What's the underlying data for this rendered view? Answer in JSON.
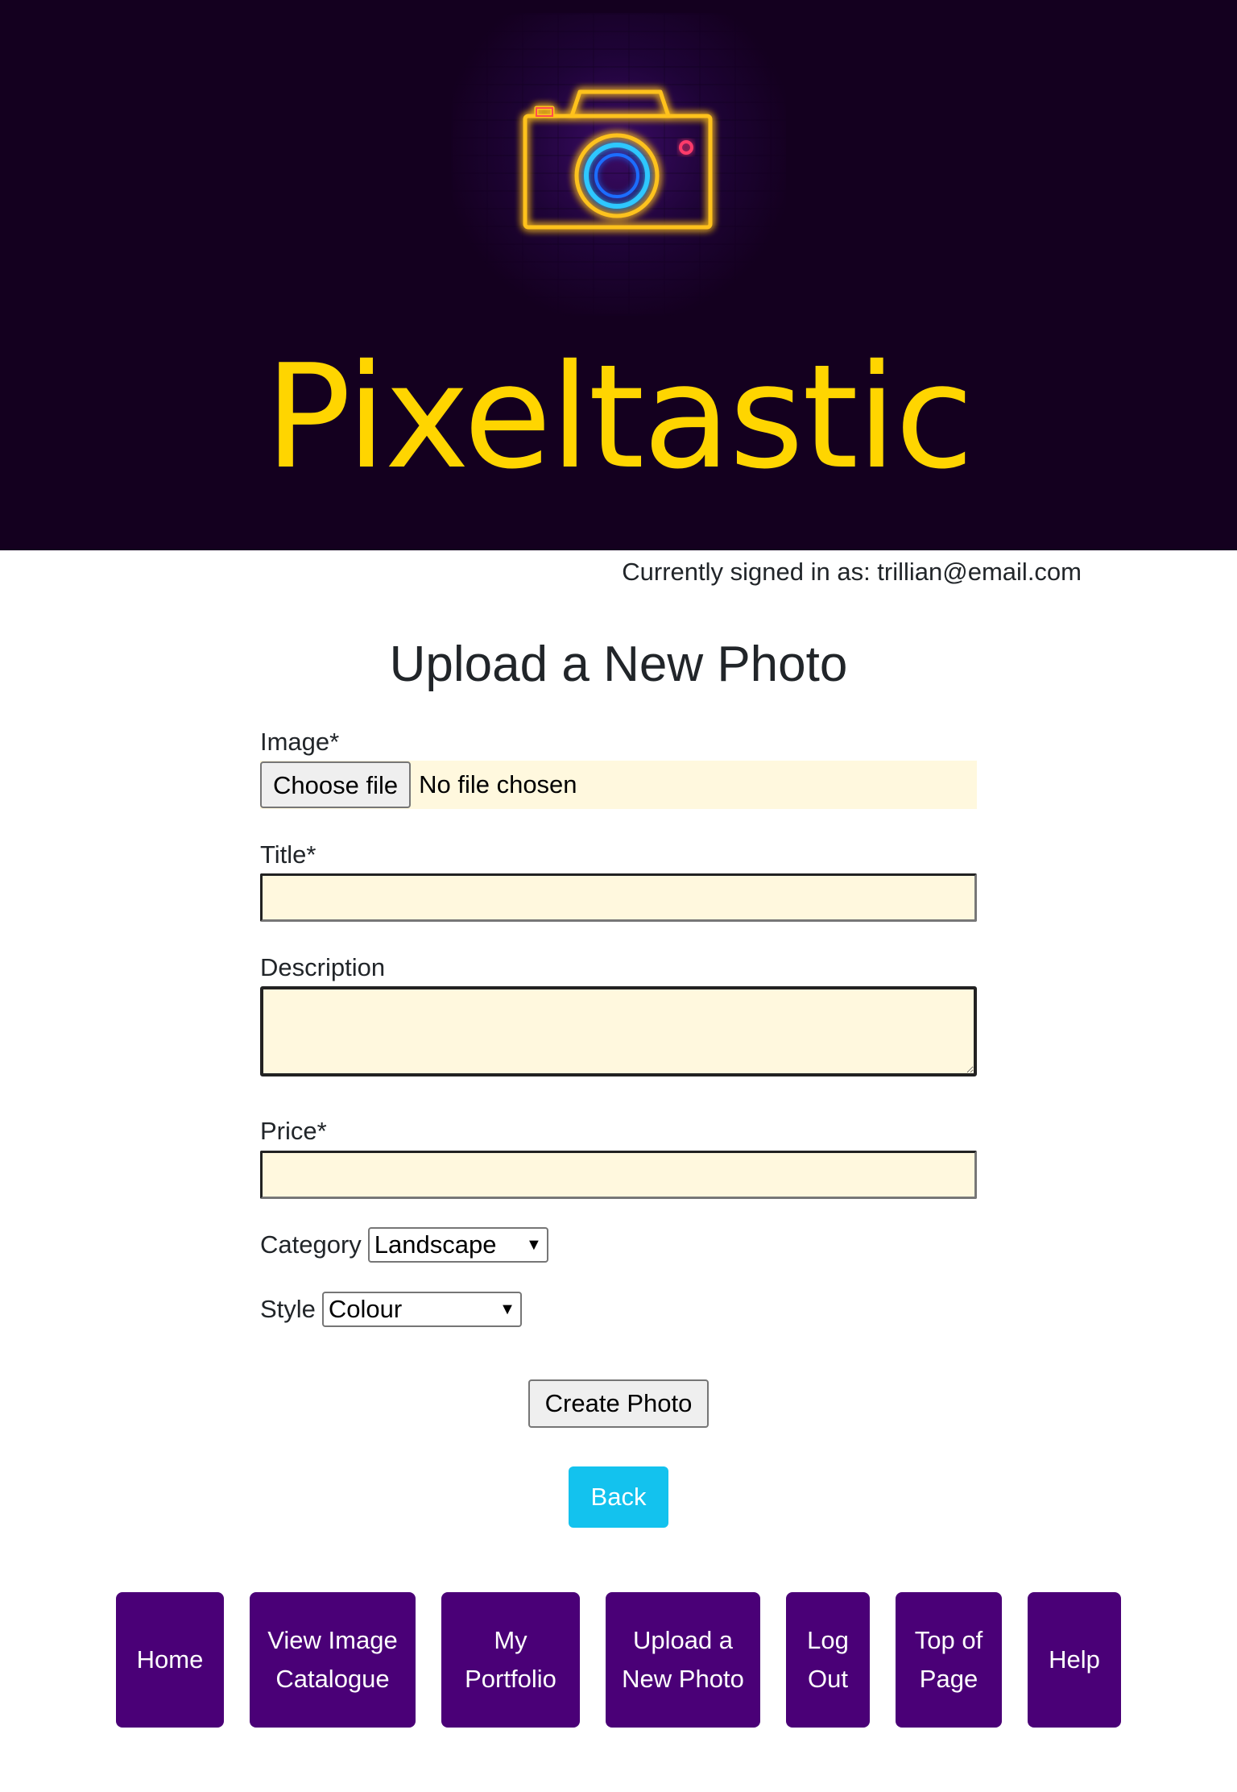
{
  "header": {
    "brand": "Pixeltastic",
    "logo_icon": "neon-camera-icon"
  },
  "user": {
    "signed_in_text": "Currently signed in as: trillian@email.com"
  },
  "form": {
    "title": "Upload a New Photo",
    "image_label": "Image*",
    "file_button_label": "Choose file",
    "file_status": "No file chosen",
    "title_label": "Title*",
    "title_value": "",
    "description_label": "Description",
    "description_value": "",
    "price_label": "Price*",
    "price_value": "",
    "category_label": "Category",
    "category_selected": "Landscape",
    "style_label": "Style",
    "style_selected": "Colour",
    "submit_label": "Create Photo",
    "back_label": "Back"
  },
  "nav": {
    "items": [
      {
        "label": "Home"
      },
      {
        "label": "View Image Catalogue"
      },
      {
        "label": "My Portfolio"
      },
      {
        "label": "Upload a New Photo"
      },
      {
        "label": "Log Out"
      },
      {
        "label": "Top of Page"
      },
      {
        "label": "Help"
      }
    ]
  },
  "colors": {
    "header_bg": "#14001f",
    "brand": "#ffd500",
    "input_bg": "#fff8de",
    "back_button": "#13c2ee",
    "nav_button": "#4a0077"
  }
}
